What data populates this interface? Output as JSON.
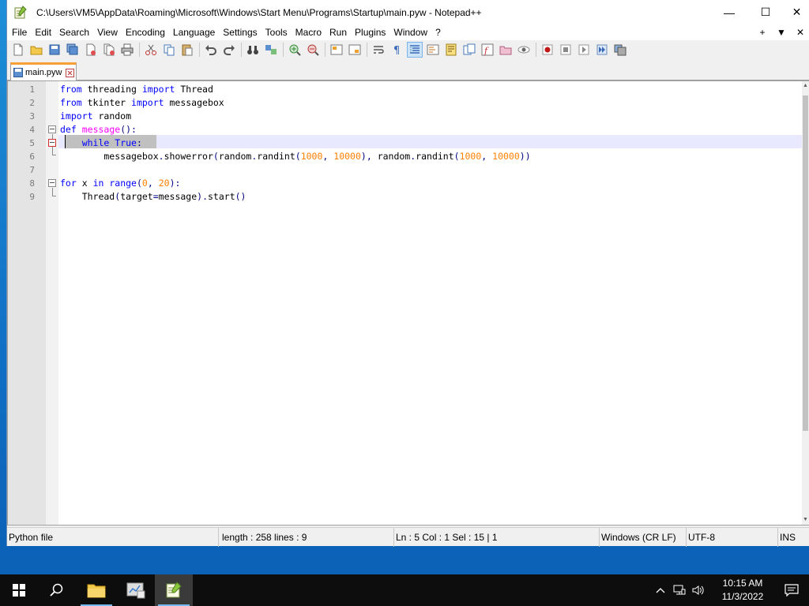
{
  "window": {
    "title": "C:\\Users\\VM5\\AppData\\Roaming\\Microsoft\\Windows\\Start Menu\\Programs\\Startup\\main.pyw - Notepad++",
    "minimize_glyph": "—",
    "maximize_glyph": "☐",
    "close_glyph": "✕"
  },
  "menu": {
    "items": [
      "File",
      "Edit",
      "Search",
      "View",
      "Encoding",
      "Language",
      "Settings",
      "Tools",
      "Macro",
      "Run",
      "Plugins",
      "Window",
      "?"
    ],
    "right": [
      "+",
      "▼",
      "✕"
    ]
  },
  "tab": {
    "label": "main.pyw"
  },
  "editor": {
    "line_numbers": [
      "1",
      "2",
      "3",
      "4",
      "5",
      "6",
      "7",
      "8",
      "9"
    ],
    "code_tokens": [
      [
        [
          "kw",
          "from"
        ],
        [
          "tx",
          " threading "
        ],
        [
          "kw",
          "import"
        ],
        [
          "tx",
          " Thread"
        ]
      ],
      [
        [
          "kw",
          "from"
        ],
        [
          "tx",
          " tkinter "
        ],
        [
          "kw",
          "import"
        ],
        [
          "tx",
          " messagebox"
        ]
      ],
      [
        [
          "kw",
          "import"
        ],
        [
          "tx",
          " random"
        ]
      ],
      [
        [
          "kw",
          "def"
        ],
        [
          "tx",
          " "
        ],
        [
          "fn",
          "message"
        ],
        [
          "op",
          "():"
        ]
      ],
      [
        [
          "tx",
          "    "
        ],
        [
          "kw",
          "while"
        ],
        [
          "tx",
          " "
        ],
        [
          "bi",
          "True"
        ],
        [
          "op",
          ":"
        ]
      ],
      [
        [
          "tx",
          "        messagebox"
        ],
        [
          "op",
          "."
        ],
        [
          "tx",
          "showerror"
        ],
        [
          "op",
          "("
        ],
        [
          "tx",
          "random"
        ],
        [
          "op",
          "."
        ],
        [
          "tx",
          "randint"
        ],
        [
          "op",
          "("
        ],
        [
          "num",
          "1000"
        ],
        [
          "op",
          ","
        ],
        [
          "tx",
          " "
        ],
        [
          "num",
          "10000"
        ],
        [
          "op",
          "),"
        ],
        [
          "tx",
          " random"
        ],
        [
          "op",
          "."
        ],
        [
          "tx",
          "randint"
        ],
        [
          "op",
          "("
        ],
        [
          "num",
          "1000"
        ],
        [
          "op",
          ","
        ],
        [
          "tx",
          " "
        ],
        [
          "num",
          "10000"
        ],
        [
          "op",
          "))"
        ]
      ],
      [],
      [
        [
          "kw",
          "for"
        ],
        [
          "tx",
          " x "
        ],
        [
          "kw",
          "in"
        ],
        [
          "tx",
          " "
        ],
        [
          "bi",
          "range"
        ],
        [
          "op",
          "("
        ],
        [
          "num",
          "0"
        ],
        [
          "op",
          ","
        ],
        [
          "tx",
          " "
        ],
        [
          "num",
          "20"
        ],
        [
          "op",
          "):"
        ]
      ],
      [
        [
          "tx",
          "    Thread"
        ],
        [
          "op",
          "("
        ],
        [
          "tx",
          "target"
        ],
        [
          "op",
          "="
        ],
        [
          "tx",
          "message"
        ],
        [
          "op",
          ")."
        ],
        [
          "tx",
          "start"
        ],
        [
          "op",
          "()"
        ]
      ]
    ]
  },
  "status": {
    "file_type": "Python file",
    "length": "length : 258    lines : 9",
    "position": "Ln : 5    Col : 1    Sel : 15 | 1",
    "eol": "Windows (CR LF)",
    "encoding": "UTF-8",
    "mode": "INS"
  },
  "taskbar": {
    "time": "10:15 AM",
    "date": "11/3/2022"
  },
  "colors": {
    "keyword": "#0000ff",
    "function": "#ff00ff",
    "number": "#ff8000",
    "tab_accent": "#f7a035",
    "taskbar": "#0d0d0d"
  }
}
